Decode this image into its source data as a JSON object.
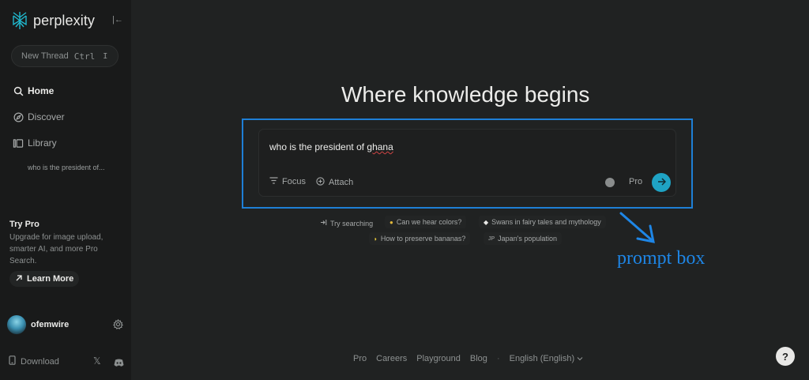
{
  "brand": {
    "name": "perplexity",
    "icon": "perplexity-logo-icon"
  },
  "sidebar": {
    "new_thread": {
      "label": "New Thread",
      "shortcut_key": "Ctrl",
      "shortcut_extra": "I"
    },
    "nav": [
      {
        "label": "Home",
        "icon": "search-icon"
      },
      {
        "label": "Discover",
        "icon": "compass-icon"
      },
      {
        "label": "Library",
        "icon": "library-icon"
      }
    ],
    "threads": [
      "who is the president of..."
    ],
    "try_pro": {
      "title": "Try Pro",
      "description": "Upgrade for image upload, smarter AI, and more Pro Search.",
      "button": "Learn More"
    },
    "user": {
      "name": "ofemwire"
    },
    "download_label": "Download"
  },
  "main": {
    "headline": "Where knowledge begins",
    "prompt": {
      "text_before": "who is the president of ",
      "text_misspelled": "ghana",
      "focus_label": "Focus",
      "attach_label": "Attach",
      "pro_label": "Pro"
    },
    "suggestions_row1": [
      {
        "label": "Try searching",
        "icon": "arrow-in-icon"
      },
      {
        "label": "Can we hear colors?",
        "icon": "emoji-icon"
      },
      {
        "label": "Swans in fairy tales and mythology",
        "icon": "swan-icon"
      }
    ],
    "suggestions_row2": [
      {
        "label": "How to preserve bananas?",
        "icon": "banana-icon"
      },
      {
        "label": "Japan's population",
        "icon": "jp-flag-icon"
      }
    ],
    "annotation": "prompt box"
  },
  "footer": {
    "links": [
      "Pro",
      "Careers",
      "Playground",
      "Blog"
    ],
    "language": "English (English)",
    "help": "?"
  },
  "colors": {
    "accent": "#1fa3c4",
    "annotation": "#1e86e6",
    "background": "#202222",
    "sidebar": "#191a1a"
  }
}
